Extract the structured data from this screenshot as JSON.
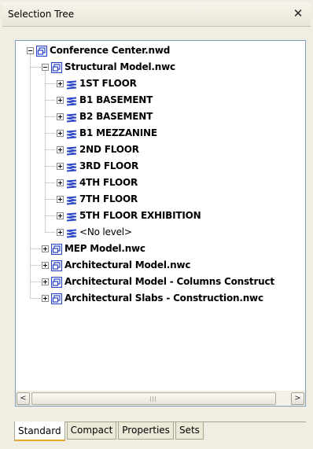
{
  "panel": {
    "title": "Selection Tree",
    "close_glyph": "✕"
  },
  "tree": {
    "root": {
      "label": "Conference Center.nwd",
      "icon": "file-icon",
      "expanded": true
    },
    "children": [
      {
        "label": "Structural Model.nwc",
        "icon": "file-icon",
        "expanded": true,
        "children": [
          {
            "label": "1ST FLOOR",
            "icon": "layer-icon"
          },
          {
            "label": "B1 BASEMENT",
            "icon": "layer-icon"
          },
          {
            "label": "B2 BASEMENT",
            "icon": "layer-icon"
          },
          {
            "label": "B1 MEZZANINE",
            "icon": "layer-icon"
          },
          {
            "label": "2ND FLOOR",
            "icon": "layer-icon"
          },
          {
            "label": "3RD FLOOR",
            "icon": "layer-icon"
          },
          {
            "label": "4TH FLOOR",
            "icon": "layer-icon"
          },
          {
            "label": "7TH FLOOR",
            "icon": "layer-icon"
          },
          {
            "label": "5TH FLOOR EXHIBITION",
            "icon": "layer-icon"
          },
          {
            "label": "<No level>",
            "icon": "layer-icon"
          }
        ]
      },
      {
        "label": "MEP Model.nwc",
        "icon": "file-icon",
        "expanded": false
      },
      {
        "label": "Architectural Model.nwc",
        "icon": "file-icon",
        "expanded": false
      },
      {
        "label": "Architectural Model - Columns Construct",
        "icon": "file-icon",
        "expanded": false
      },
      {
        "label": "Architectural Slabs - Construction.nwc",
        "icon": "file-icon",
        "expanded": false
      }
    ]
  },
  "scrollbar": {
    "left_glyph": "<",
    "right_glyph": ">"
  },
  "tabs": [
    {
      "label": "Standard",
      "active": true
    },
    {
      "label": "Compact",
      "active": false
    },
    {
      "label": "Properties",
      "active": false
    },
    {
      "label": "Sets",
      "active": false
    }
  ],
  "colors": {
    "icon_blue": "#2a44c8",
    "active_tab_underline": "#e6a72b",
    "tree_border": "#7f9db9"
  }
}
